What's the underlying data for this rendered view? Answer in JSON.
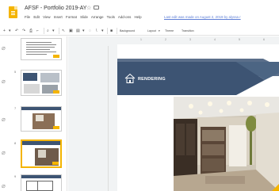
{
  "app": {
    "title": "AFSF - Portfolio 2019-AY",
    "star_icon": "star-icon",
    "folder_icon": "folder-icon",
    "last_edit": "Last edit was made on August 2, 2019 by alyssa r"
  },
  "menu": [
    "File",
    "Edit",
    "View",
    "Insert",
    "Format",
    "Slide",
    "Arrange",
    "Tools",
    "Add-ons",
    "Help"
  ],
  "toolbar": {
    "background_label": "Background",
    "layout_label": "Layout",
    "theme_label": "Theme",
    "transition_label": "Transition"
  },
  "ruler_ticks": [
    "1",
    "2",
    "3",
    "4",
    "5",
    "6"
  ],
  "filmstrip": {
    "slides": [
      {
        "number": "",
        "kind": "text"
      },
      {
        "number": "5",
        "kind": "layout"
      },
      {
        "number": "7",
        "kind": "photo"
      },
      {
        "number": "8",
        "kind": "photo-selected"
      },
      {
        "number": "9",
        "kind": "plan"
      }
    ]
  },
  "slide": {
    "banner_title": "RENDERING",
    "banner_color": "#3d5473",
    "accent_color": "#f4b400",
    "icon": "house-icon"
  },
  "colors": {
    "accent": "#f4b400",
    "link": "#5f7fd6"
  }
}
